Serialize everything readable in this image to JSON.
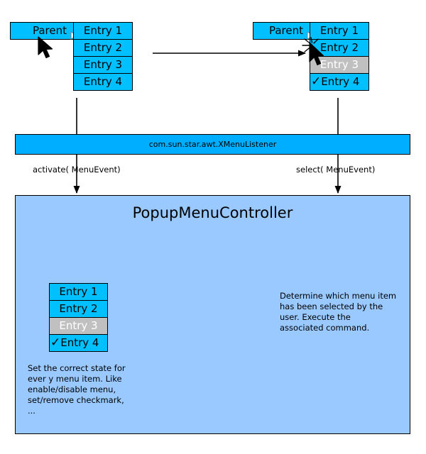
{
  "diagram": {
    "title": "PopupMenuController",
    "listener_interface": "com.sun.star.awt.XMenuListener",
    "edges": {
      "activate_label": "activate( MenuEvent)",
      "select_label": "select( MenuEvent)"
    },
    "colors": {
      "menu_enabled": "#00c0ff",
      "menu_disabled": "#c0c0c0",
      "listener_band": "#00aeff",
      "controller_panel": "#99c9ff",
      "outline": "#000000",
      "disabled_text": "#ffffff"
    }
  },
  "menu_before": {
    "name": "menu-before-click",
    "parent": {
      "label": "Parent",
      "submenu_indicator": "submenu-arrow-icon"
    },
    "items": [
      {
        "label": "Entry 1",
        "state": "enabled",
        "checked": false
      },
      {
        "label": "Entry 2",
        "state": "enabled",
        "checked": false
      },
      {
        "label": "Entry 3",
        "state": "enabled",
        "checked": false
      },
      {
        "label": "Entry 4",
        "state": "enabled",
        "checked": false
      }
    ],
    "cursor": {
      "icon": "mouse-pointer-icon",
      "on": "Parent",
      "clicking": false
    }
  },
  "menu_after": {
    "name": "menu-after-activate",
    "parent": {
      "label": "Parent",
      "submenu_indicator": "submenu-arrow-icon"
    },
    "items": [
      {
        "label": "Entry 1",
        "state": "enabled",
        "checked": false
      },
      {
        "label": "Entry 2",
        "state": "enabled",
        "checked": false
      },
      {
        "label": "Entry 3",
        "state": "disabled",
        "checked": false
      },
      {
        "label": "Entry 4",
        "state": "enabled",
        "checked": true
      }
    ],
    "checkmark_glyph": "✓",
    "cursor": {
      "icon": "mouse-pointer-click-icon",
      "on": "Entry 2",
      "clicking": true
    }
  },
  "menu_controller_preview": {
    "name": "menu-state-preview",
    "items": [
      {
        "label": "Entry 1",
        "state": "enabled",
        "checked": false
      },
      {
        "label": "Entry 2",
        "state": "enabled",
        "checked": false
      },
      {
        "label": "Entry 3",
        "state": "disabled",
        "checked": false
      },
      {
        "label": "Entry 4",
        "state": "enabled",
        "checked": true
      }
    ],
    "checkmark_glyph": "✓"
  },
  "notes": {
    "left": "Set the correct state for\never y menu item. Like\nenable/disable menu,\nset/remove checkmark,\n...",
    "right": "Determine which menu item\nhas been selected by the\nuser. Execute the\nassociated command."
  }
}
